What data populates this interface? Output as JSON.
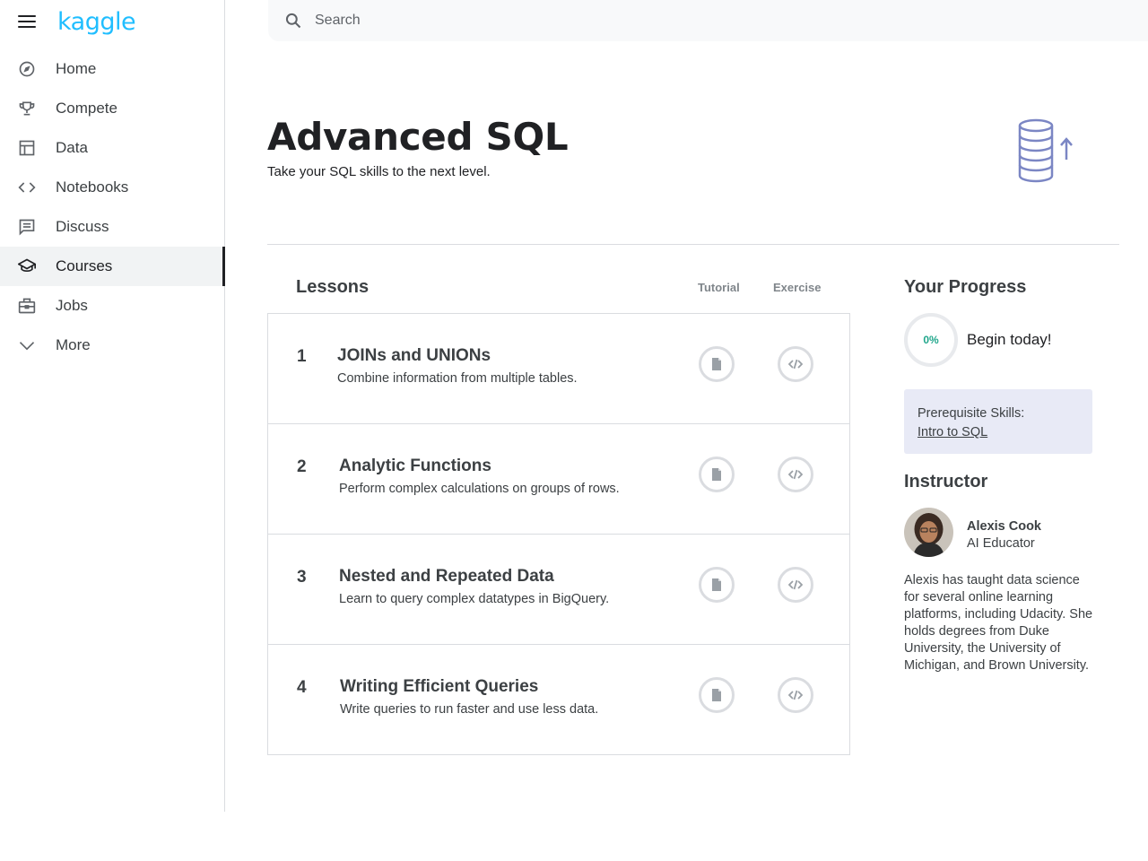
{
  "sidebar": {
    "logo": "kaggle",
    "items": [
      {
        "label": "Home",
        "icon": "compass-icon"
      },
      {
        "label": "Compete",
        "icon": "trophy-icon"
      },
      {
        "label": "Data",
        "icon": "table-icon"
      },
      {
        "label": "Notebooks",
        "icon": "code-icon"
      },
      {
        "label": "Discuss",
        "icon": "comment-icon"
      },
      {
        "label": "Courses",
        "icon": "school-icon",
        "active": true
      },
      {
        "label": "Jobs",
        "icon": "briefcase-icon"
      },
      {
        "label": "More",
        "icon": "chevron-down-icon"
      }
    ]
  },
  "search": {
    "placeholder": "Search"
  },
  "header": {
    "title": "Advanced SQL",
    "subtitle": "Take your SQL skills to the next level."
  },
  "lessons": {
    "heading": "Lessons",
    "col_tutorial": "Tutorial",
    "col_exercise": "Exercise",
    "items": [
      {
        "num": "1",
        "title": "JOINs and UNIONs",
        "desc": "Combine information from multiple tables."
      },
      {
        "num": "2",
        "title": "Analytic Functions",
        "desc": "Perform complex calculations on groups of rows."
      },
      {
        "num": "3",
        "title": "Nested and Repeated Data",
        "desc": "Learn to query complex datatypes in BigQuery."
      },
      {
        "num": "4",
        "title": "Writing Efficient Queries",
        "desc": "Write queries to run faster and use less data."
      }
    ]
  },
  "progress": {
    "heading": "Your Progress",
    "percent": "0%",
    "text": "Begin today!"
  },
  "prereq": {
    "label": "Prerequisite Skills:",
    "link": "Intro to SQL"
  },
  "instructor": {
    "heading": "Instructor",
    "name": "Alexis Cook",
    "role": "AI Educator",
    "bio": "Alexis has taught data science for several online learning platforms, including Udacity. She holds degrees from Duke University, the University of Michigan, and Brown University."
  },
  "colors": {
    "brand": "#20beff",
    "hero_icon": "#7b86c4",
    "progress_text": "#20a68b",
    "prereq_bg": "#e8eaf6"
  }
}
